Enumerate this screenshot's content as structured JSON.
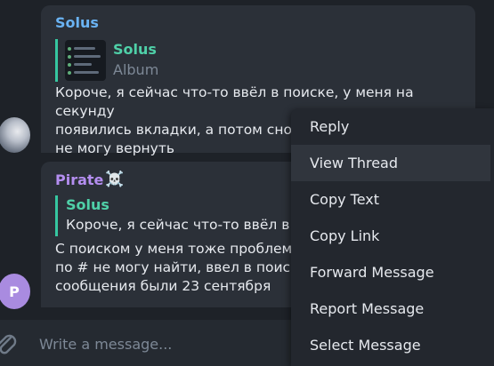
{
  "messages": [
    {
      "sender": "Solus",
      "reply_to": {
        "name": "Solus",
        "preview": "Album"
      },
      "text": "Короче, я сейчас что-то ввёл в поиске, у меня на секунду\nпоявились вкладки, а потом снова\nне могу вернуть"
    },
    {
      "sender": "Pirate",
      "sender_emoji": "☠️",
      "avatar_letter": "P",
      "reply_to": {
        "name": "Solus",
        "preview": "Короче, я сейчас что-то ввёл в п"
      },
      "text": "С поиском у меня тоже проблемы\nпо # не могу найти, ввел в поиске\nсообщения были 23 сентября"
    }
  ],
  "composer": {
    "placeholder": "Write a message..."
  },
  "context_menu": {
    "items": [
      {
        "label": "Reply"
      },
      {
        "label": "View Thread",
        "highlighted": true
      },
      {
        "label": "Copy Text"
      },
      {
        "label": "Copy Link"
      },
      {
        "label": "Forward Message"
      },
      {
        "label": "Report Message"
      },
      {
        "label": "Select Message"
      }
    ]
  },
  "colors": {
    "background": "#1e2228",
    "bubble": "#2b3038",
    "sender_solus": "#6ab3f3",
    "sender_pirate": "#b48ef0",
    "quote_accent": "#36c7a0",
    "avatar_p": "#a98be0",
    "menu_bg": "#23272e",
    "menu_highlight": "#30353d"
  },
  "icons": [
    "attach-icon",
    "skull-emoji"
  ]
}
